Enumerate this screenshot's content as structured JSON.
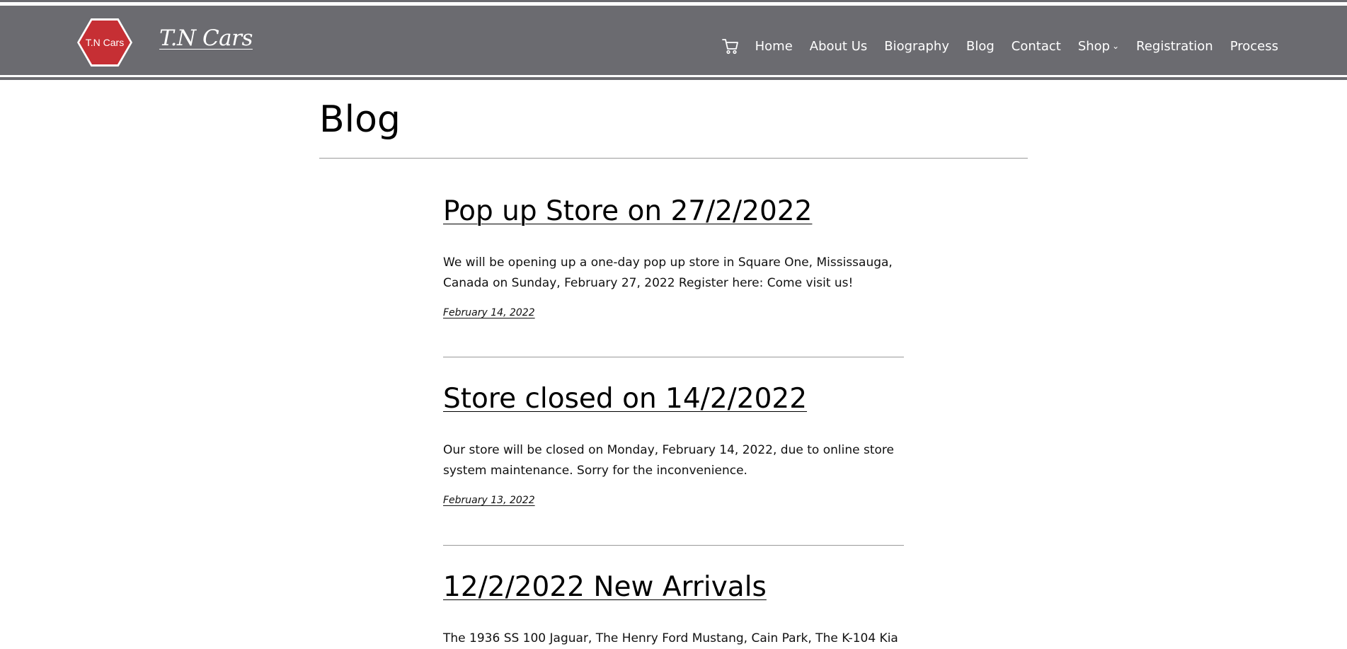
{
  "site": {
    "logo_text": "T.N Cars",
    "title": "T.N Cars"
  },
  "nav": {
    "cart_icon": "cart-icon",
    "items": [
      {
        "label": "Home"
      },
      {
        "label": "About Us"
      },
      {
        "label": "Biography"
      },
      {
        "label": "Blog"
      },
      {
        "label": "Contact"
      },
      {
        "label": "Shop",
        "has_submenu": true
      },
      {
        "label": "Registration"
      },
      {
        "label": "Process"
      }
    ]
  },
  "page": {
    "title": "Blog"
  },
  "posts": [
    {
      "title": "Pop up Store on 27/2/2022",
      "excerpt": "We will be opening up a one-day pop up store in Square One, Mississauga, Canada on Sunday, February 27, 2022 Register here: Come visit us!",
      "date": "February 14, 2022"
    },
    {
      "title": "Store closed on 14/2/2022",
      "excerpt": "Our store will be closed on Monday, February 14, 2022, due to online store system maintenance. Sorry for the inconvenience.",
      "date": "February 13, 2022"
    },
    {
      "title": "12/2/2022 New Arrivals",
      "excerpt": "The 1936 SS 100 Jaguar, The Henry Ford Mustang, Cain Park, The K-104 Kia",
      "date": ""
    }
  ],
  "colors": {
    "header_bg": "#6b6b70",
    "logo_red": "#c62f34",
    "text": "#111111",
    "rule": "#9a9a9a"
  }
}
